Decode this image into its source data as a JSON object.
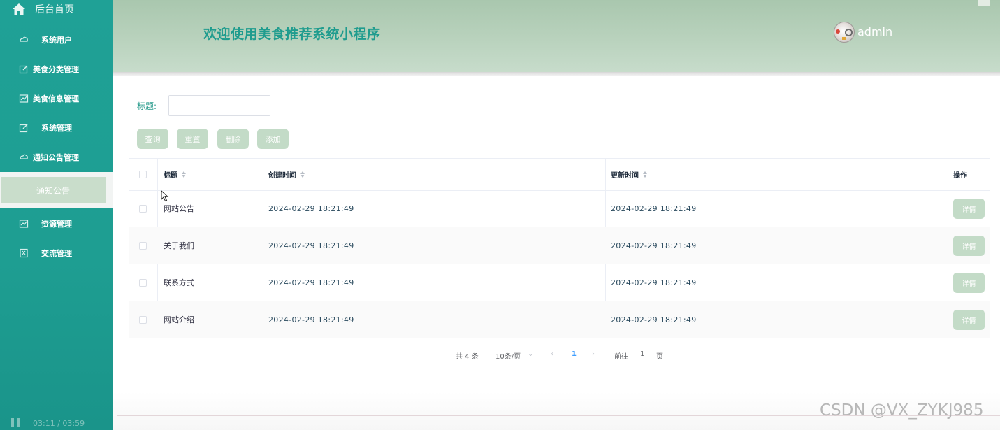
{
  "sidebar": {
    "home_label": "后台首页",
    "items": [
      {
        "label": "系统用户",
        "icon": "cloud-icon"
      },
      {
        "label": "美食分类管理",
        "icon": "edit-icon"
      },
      {
        "label": "美食信息管理",
        "icon": "chart-icon"
      },
      {
        "label": "系统管理",
        "icon": "edit-icon"
      },
      {
        "label": "通知公告管理",
        "icon": "cloud-icon"
      },
      {
        "label": "资源管理",
        "icon": "chart-icon"
      },
      {
        "label": "交流管理",
        "icon": "bookmark-icon"
      }
    ],
    "active_sub": "通知公告"
  },
  "header": {
    "title": "欢迎使用美食推荐系统小程序",
    "username": "admin"
  },
  "filter": {
    "label": "标题:",
    "value": "",
    "placeholder": ""
  },
  "buttons": {
    "query": "查询",
    "reset": "重置",
    "delete": "删除",
    "add": "添加"
  },
  "table": {
    "headers": {
      "title": "标题",
      "created": "创建时间",
      "updated": "更新时间",
      "actions": "操作"
    },
    "rows": [
      {
        "title": "网站公告",
        "created": "2024-02-29 18:21:49",
        "updated": "2024-02-29 18:21:49",
        "action": "详情"
      },
      {
        "title": "关于我们",
        "created": "2024-02-29 18:21:49",
        "updated": "2024-02-29 18:21:49",
        "action": "详情"
      },
      {
        "title": "联系方式",
        "created": "2024-02-29 18:21:49",
        "updated": "2024-02-29 18:21:49",
        "action": "详情"
      },
      {
        "title": "网站介绍",
        "created": "2024-02-29 18:21:49",
        "updated": "2024-02-29 18:21:49",
        "action": "详情"
      }
    ]
  },
  "pagination": {
    "total": "共 4 条",
    "page_size": "10条/页",
    "current_page": "1",
    "goto_prefix": "前往",
    "goto_value": "1",
    "goto_suffix": "页"
  },
  "player": {
    "time": "03:11  /  03:59"
  },
  "watermark": "CSDN @VX_ZYKJ985",
  "colors": {
    "sidebar": "#1fa196",
    "accent": "#1f9c8e",
    "button": "#c3dbc7",
    "header": "#b9d2bd",
    "pagination_active": "#409eff"
  }
}
